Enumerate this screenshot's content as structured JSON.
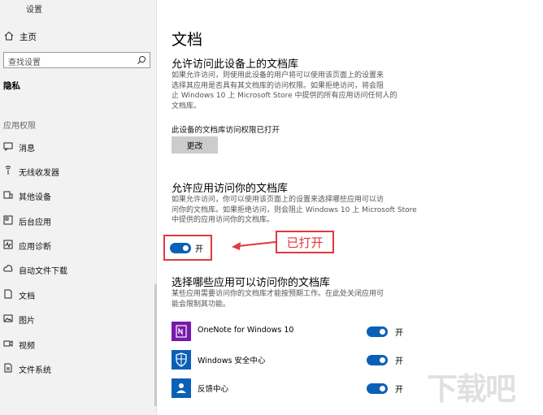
{
  "window": {
    "title": "设置"
  },
  "sidebar": {
    "home_label": "主页",
    "search_placeholder": "查找设置",
    "section": "隐私",
    "group": "应用权限",
    "items": [
      {
        "label": "消息",
        "icon": "message-icon"
      },
      {
        "label": "无线收发器",
        "icon": "radio-icon"
      },
      {
        "label": "其他设备",
        "icon": "other-devices-icon"
      },
      {
        "label": "后台应用",
        "icon": "background-apps-icon"
      },
      {
        "label": "应用诊断",
        "icon": "app-diagnostics-icon"
      },
      {
        "label": "自动文件下载",
        "icon": "cloud-download-icon"
      },
      {
        "label": "文档",
        "icon": "document-icon"
      },
      {
        "label": "图片",
        "icon": "picture-icon"
      },
      {
        "label": "视频",
        "icon": "video-icon"
      },
      {
        "label": "文件系统",
        "icon": "file-system-icon"
      }
    ]
  },
  "main": {
    "title": "文档",
    "device_heading": "允许访问此设备上的文档库",
    "device_desc": [
      "如果允许访问，则使用此设备的用户将可以使用该页面上的设置来",
      "选择其应用是否具有其文档库的访问权限。如果拒绝访问，将会阻",
      "止 Windows 10 上 Microsoft Store 中提供的所有应用访问任何人的",
      "文档库。"
    ],
    "device_status": "此设备的文档库访问权限已打开",
    "change_button": "更改",
    "apps_heading": "允许应用访问你的文档库",
    "apps_desc": [
      "如果允许访问，你可以使用该页面上的设置来选择哪些应用可以访",
      "问你的文档库。如果拒绝访问，则会阻止 Windows 10 上 Microsoft Store",
      "中提供的应用访问你的文档库。"
    ],
    "toggle_label": "开",
    "annotation": "已打开",
    "choose_heading": "选择哪些应用可以访问你的文档库",
    "choose_desc": [
      "某些应用需要访问你的文档库才能按预期工作。在此处关闭应用可",
      "能会限制其功能。"
    ],
    "apps": [
      {
        "name": "OneNote for Windows 10",
        "state": "开",
        "icon": "onenote-icon",
        "color": "#7719aa"
      },
      {
        "name": "Windows 安全中心",
        "state": "开",
        "icon": "shield-icon",
        "color": "#0a60b6"
      },
      {
        "name": "反馈中心",
        "state": "开",
        "icon": "feedback-icon",
        "color": "#0a60b6"
      }
    ]
  },
  "watermark": "下载吧",
  "colors": {
    "accent": "#0a60b6",
    "annotation": "#e0393e"
  }
}
